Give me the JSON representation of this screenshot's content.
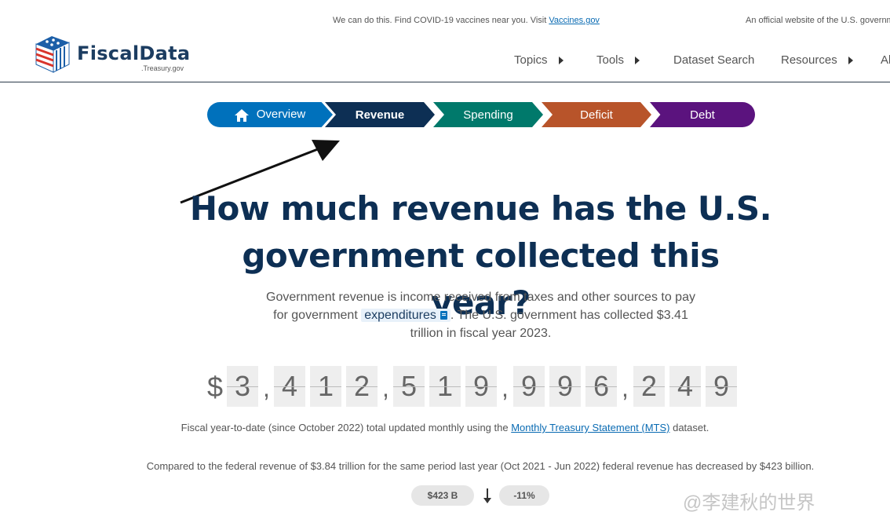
{
  "banner": {
    "covid_text": "We can do this. Find COVID-19 vaccines near you. Visit ",
    "covid_link": "Vaccines.gov",
    "official_text": "An official website of the U.S. governm"
  },
  "logo": {
    "name": "FiscalData",
    "sub": ".Treasury.gov"
  },
  "nav": {
    "items": [
      {
        "label": "Topics"
      },
      {
        "label": "Tools"
      },
      {
        "label": "Dataset Search"
      },
      {
        "label": "Resources"
      },
      {
        "label": "Al"
      }
    ]
  },
  "tabs": {
    "overview": "Overview",
    "revenue": "Revenue",
    "spending": "Spending",
    "deficit": "Deficit",
    "debt": "Debt"
  },
  "colors": {
    "overview": "#0071bc",
    "revenue": "#0d2f54",
    "spending": "#00796b",
    "deficit": "#b8542a",
    "debt": "#5b137e"
  },
  "headline": {
    "line1": "How much revenue has the U.S.",
    "line2": "government collected this year?"
  },
  "intro": {
    "part1": "Government revenue is income received from taxes and other sources to pay for government ",
    "glossary_term": "expenditures",
    "part2": ". The U.S. government has collected $3.41 trillion in fiscal year 2023."
  },
  "counter": {
    "currency": "$",
    "digits": [
      "3",
      "4",
      "1",
      "2",
      "5",
      "1",
      "9",
      "9",
      "9",
      "6",
      "2",
      "4",
      "9"
    ],
    "separator": ","
  },
  "note": {
    "text_before": "Fiscal year-to-date (since October 2022) total updated monthly using the ",
    "link": "Monthly Treasury Statement (MTS)",
    "text_after": " dataset."
  },
  "compare": {
    "text": "Compared to the federal revenue of $3.84 trillion for the same period last year (Oct 2021 - Jun 2022) federal revenue has decreased by $423 billion."
  },
  "pills": {
    "amount": "$423 B",
    "percent": "-11%"
  },
  "watermark": "@李建秋的世界"
}
